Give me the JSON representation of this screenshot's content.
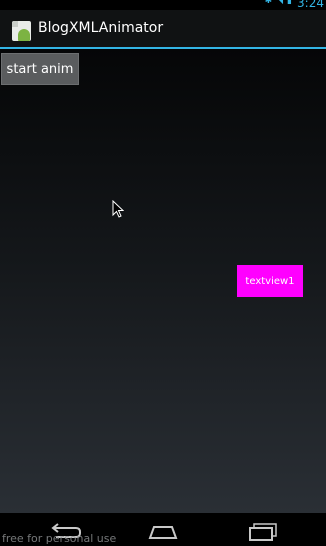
{
  "status_bar": {
    "clock": "3:24",
    "icons": [
      "bluetooth-icon",
      "wifi-icon",
      "battery-icon"
    ],
    "accent_color": "#33b5e5"
  },
  "action_bar": {
    "title": "BlogXMLAnimator",
    "app_icon": "android-app-icon"
  },
  "main": {
    "start_button_label": "start anim",
    "textview_label": "textview1",
    "textview_color": "#ff00ff"
  },
  "nav_bar": {
    "buttons": [
      "back-icon",
      "home-icon",
      "recent-apps-icon"
    ],
    "watermark": "free for personal use"
  }
}
